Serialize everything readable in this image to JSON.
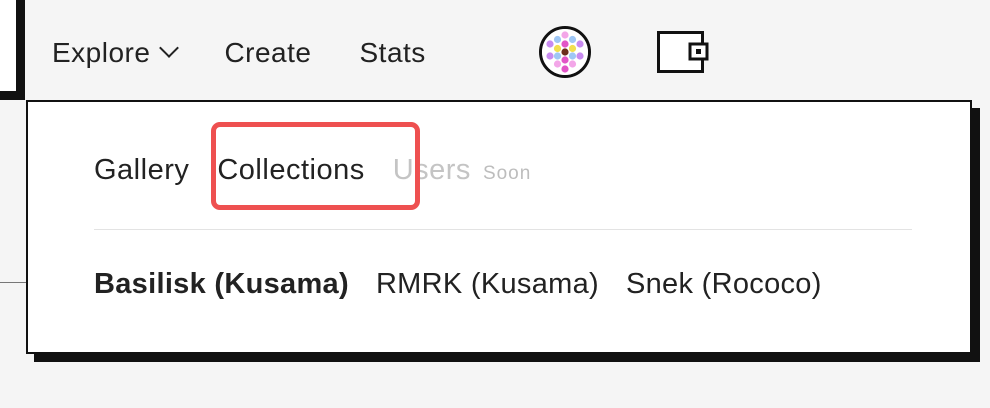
{
  "nav": {
    "explore_label": "Explore",
    "create_label": "Create",
    "stats_label": "Stats"
  },
  "icons": {
    "explore_chevron": "chevron-down-icon",
    "avatar": "identicon-avatar",
    "wallet": "wallet-icon"
  },
  "explore_menu": {
    "tabs": [
      {
        "label": "Gallery"
      },
      {
        "label": "Collections"
      },
      {
        "label": "Users",
        "badge": "Soon",
        "disabled": true
      }
    ],
    "selected_tab": "Collections",
    "chains": [
      {
        "label": "Basilisk (Kusama)",
        "active": true
      },
      {
        "label": "RMRK (Kusama)",
        "active": false
      },
      {
        "label": "Snek (Rococo)",
        "active": false
      }
    ]
  },
  "colors": {
    "highlight": "#ee5050",
    "text": "#222222",
    "disabled_text": "#c4c4c4",
    "background": "#f5f5f5",
    "surface": "#ffffff"
  }
}
